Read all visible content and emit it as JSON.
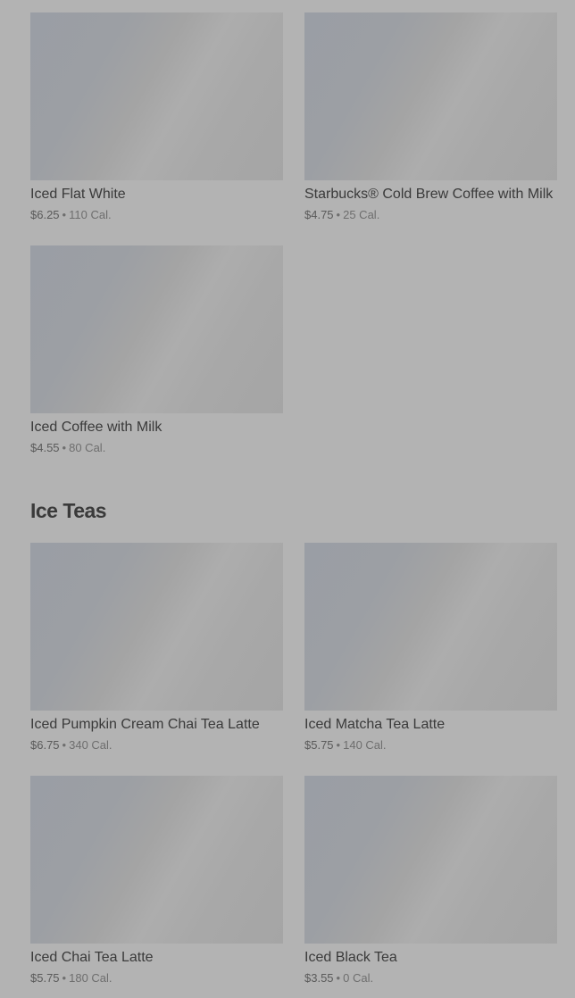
{
  "coffee_items": [
    {
      "name": "Iced Flat White",
      "price": "$6.25",
      "calories": "110 Cal."
    },
    {
      "name": "Starbucks® Cold Brew Coffee with Milk",
      "price": "$4.75",
      "calories": "25 Cal."
    },
    {
      "name": "Iced Coffee with Milk",
      "price": "$4.55",
      "calories": "80 Cal."
    }
  ],
  "ice_teas": {
    "title": "Ice Teas",
    "items": [
      {
        "name": "Iced Pumpkin Cream Chai Tea Latte",
        "price": "$6.75",
        "calories": "340 Cal."
      },
      {
        "name": "Iced Matcha Tea Latte",
        "price": "$5.75",
        "calories": "140 Cal."
      },
      {
        "name": "Iced Chai Tea Latte",
        "price": "$5.75",
        "calories": "180 Cal."
      },
      {
        "name": "Iced Black Tea",
        "price": "$3.55",
        "calories": "0 Cal."
      }
    ]
  },
  "separator": "•"
}
